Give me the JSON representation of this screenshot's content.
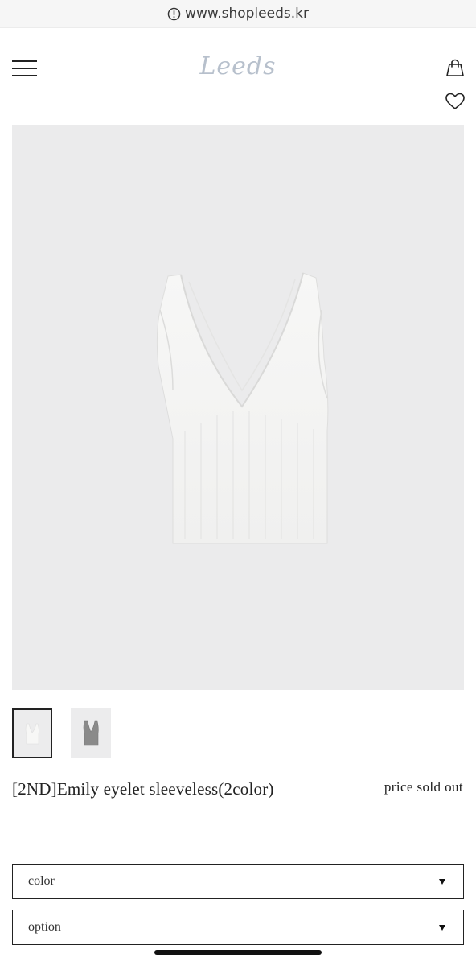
{
  "browser": {
    "url": "www.shopleeds.kr",
    "url_icon": "info-circle-icon"
  },
  "header": {
    "logo_text": "Leeds",
    "menu_icon": "hamburger-menu-icon",
    "cart_icon": "shopping-bag-icon",
    "wishlist_icon": "heart-icon"
  },
  "product": {
    "image_subject": "white v-neck eyelet sleeveless knit top",
    "thumbnails": [
      {
        "color_name": "white",
        "swatch": "#f4f4f4",
        "selected": true
      },
      {
        "color_name": "gray",
        "swatch": "#8a8a8a",
        "selected": false
      }
    ],
    "name": "[2ND]Emily eyelet sleeveless(2color)",
    "price": "price sold out"
  },
  "options": {
    "color_label": "color",
    "option_label": "option"
  },
  "colors": {
    "border": "#222222",
    "image_bg": "#ebebec",
    "logo": "#b7c0cc"
  }
}
